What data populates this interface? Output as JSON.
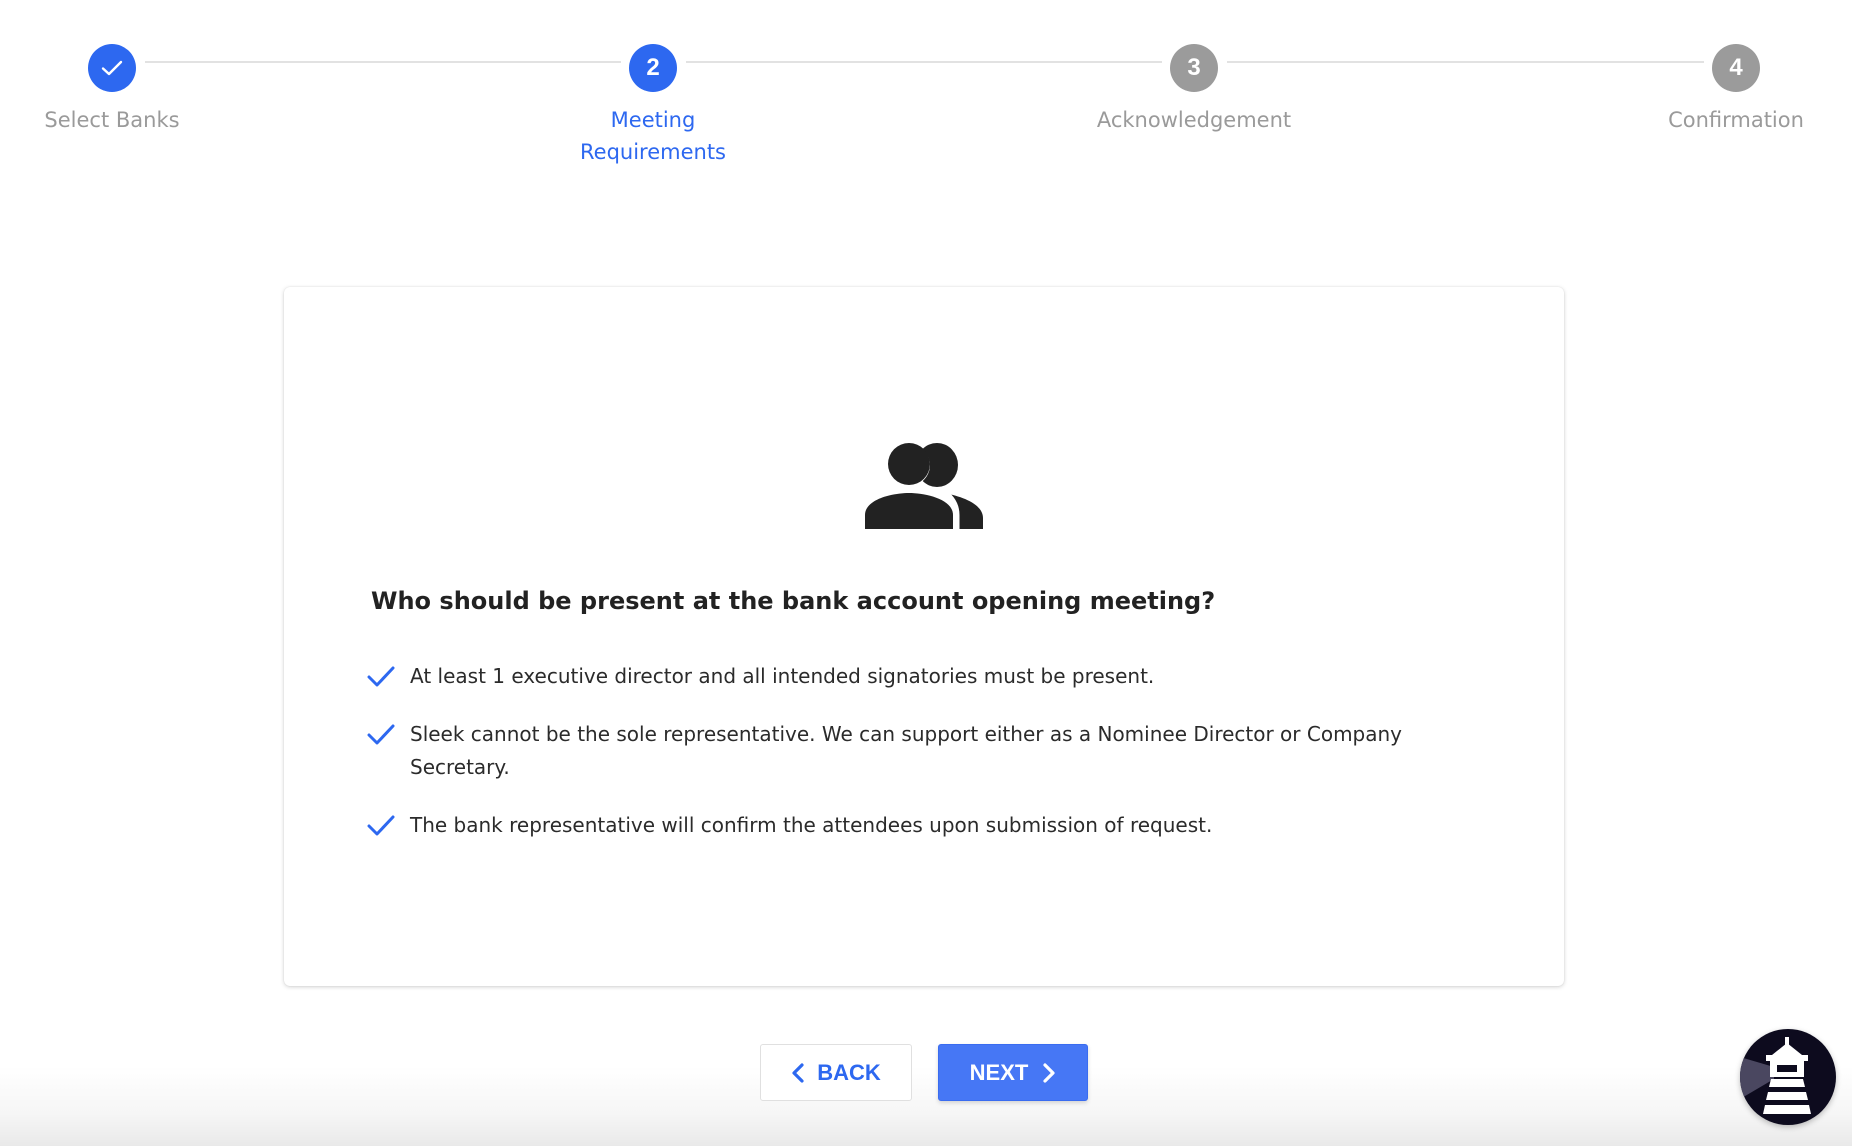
{
  "stepper": {
    "steps": [
      {
        "number": "1",
        "label": "Select Banks",
        "state": "done",
        "icon": "check-icon"
      },
      {
        "number": "2",
        "label_line1": "Meeting",
        "label_line2": "Requirements",
        "state": "active"
      },
      {
        "number": "3",
        "label": "Acknowledgement",
        "state": "todo"
      },
      {
        "number": "4",
        "label": "Confirmation",
        "state": "todo"
      }
    ]
  },
  "card": {
    "icon": "people-icon",
    "title": "Who should be present at the bank account opening meeting?",
    "requirements": [
      "At least 1 executive director and all intended signatories must be present.",
      "Sleek cannot be the sole representative. We can support either as a Nominee Director or Company Secretary.",
      "The bank representative will confirm the attendees upon submission of request."
    ]
  },
  "actions": {
    "back_label": "BACK",
    "next_label": "NEXT"
  },
  "chat_widget": {
    "icon": "lighthouse-icon"
  },
  "colors": {
    "accent": "#2d68f0",
    "next_button": "#4677f5",
    "inactive_step": "#9b9b9b",
    "text": "#222222",
    "muted": "#9a9a9a"
  }
}
